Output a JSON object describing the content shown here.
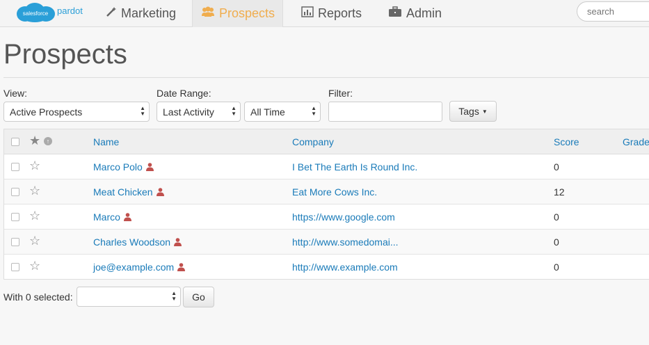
{
  "brand": {
    "cloud_text": "salesforce",
    "product": "pardot"
  },
  "nav": [
    {
      "label": "Marketing",
      "icon": "magic-wand-icon"
    },
    {
      "label": "Prospects",
      "icon": "users-icon",
      "active": true
    },
    {
      "label": "Reports",
      "icon": "bar-chart-icon"
    },
    {
      "label": "Admin",
      "icon": "briefcase-icon"
    }
  ],
  "search": {
    "placeholder": "search"
  },
  "page": {
    "title": "Prospects"
  },
  "filters": {
    "view_label": "View:",
    "view_value": "Active Prospects",
    "date_range_label": "Date Range:",
    "date_field_value": "Last Activity",
    "date_period_value": "All Time",
    "filter_label": "Filter:",
    "filter_value": "",
    "tags_label": "Tags"
  },
  "table": {
    "columns": [
      "Name",
      "Company",
      "Score",
      "Grade"
    ],
    "rows": [
      {
        "name": "Marco Polo",
        "company": "I Bet The Earth Is Round Inc.",
        "score": "0"
      },
      {
        "name": "Meat Chicken",
        "company": "Eat More Cows Inc.",
        "score": "12"
      },
      {
        "name": "Marco",
        "company": "https://www.google.com",
        "score": "0"
      },
      {
        "name": "Charles Woodson",
        "company": "http://www.somedomai...",
        "score": "0"
      },
      {
        "name": "joe@example.com",
        "company": "http://www.example.com",
        "score": "0"
      }
    ]
  },
  "bulk": {
    "label": "With 0 selected:",
    "action_value": "",
    "go_label": "Go"
  },
  "colors": {
    "accent": "#f0ad4e",
    "link": "#1a7bb9",
    "person_icon": "#c0504d",
    "brand_blue": "#2a9fd8"
  }
}
